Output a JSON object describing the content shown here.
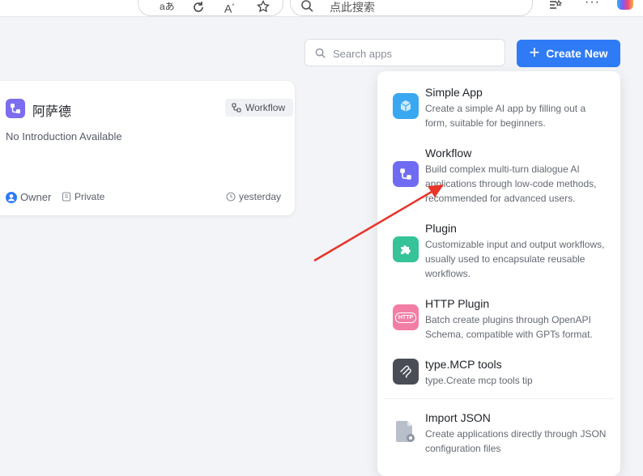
{
  "browser": {
    "search_text": "点此搜索",
    "icons": [
      "translate-icon",
      "refresh-icon",
      "read-aloud-icon",
      "favorite-star-icon",
      "favorites-list-icon",
      "more-icon",
      "copilot-icon"
    ]
  },
  "toolbar": {
    "search_placeholder": "Search apps",
    "create_label": "Create New"
  },
  "app_card": {
    "name": "阿萨德",
    "type": "Workflow",
    "intro": "No Introduction Available",
    "owner": "Owner",
    "visibility": "Private",
    "updated": "yesterday"
  },
  "create_menu": {
    "items": [
      {
        "title": "Simple App",
        "desc": "Create a simple AI app by filling out a form, suitable for beginners.",
        "icon": "cube-icon",
        "color": "#3aa8f0"
      },
      {
        "title": "Workflow",
        "desc": "Build complex multi-turn dialogue AI applications through low-code methods, recommended for advanced users.",
        "icon": "workflow-icon",
        "color": "#6f6cf3"
      },
      {
        "title": "Plugin",
        "desc": "Customizable input and output workflows, usually used to encapsulate reusable workflows.",
        "icon": "puzzle-icon",
        "color": "#36c39a"
      },
      {
        "title": "HTTP Plugin",
        "desc": "Batch create plugins through OpenAPI Schema, compatible with GPTs format.",
        "icon": "http-icon",
        "color": "#f37ea5",
        "badge": "HTTP"
      },
      {
        "title": "type.MCP tools",
        "desc": "type.Create mcp tools tip",
        "icon": "mcp-icon",
        "color": "#4a4d55"
      },
      {
        "title": "Import JSON",
        "desc": "Create applications directly through JSON configuration files",
        "icon": "json-file-icon",
        "color": "#8d95a3"
      }
    ]
  },
  "colors": {
    "accent": "#2f7bf6",
    "annotation": "#e8342a"
  }
}
